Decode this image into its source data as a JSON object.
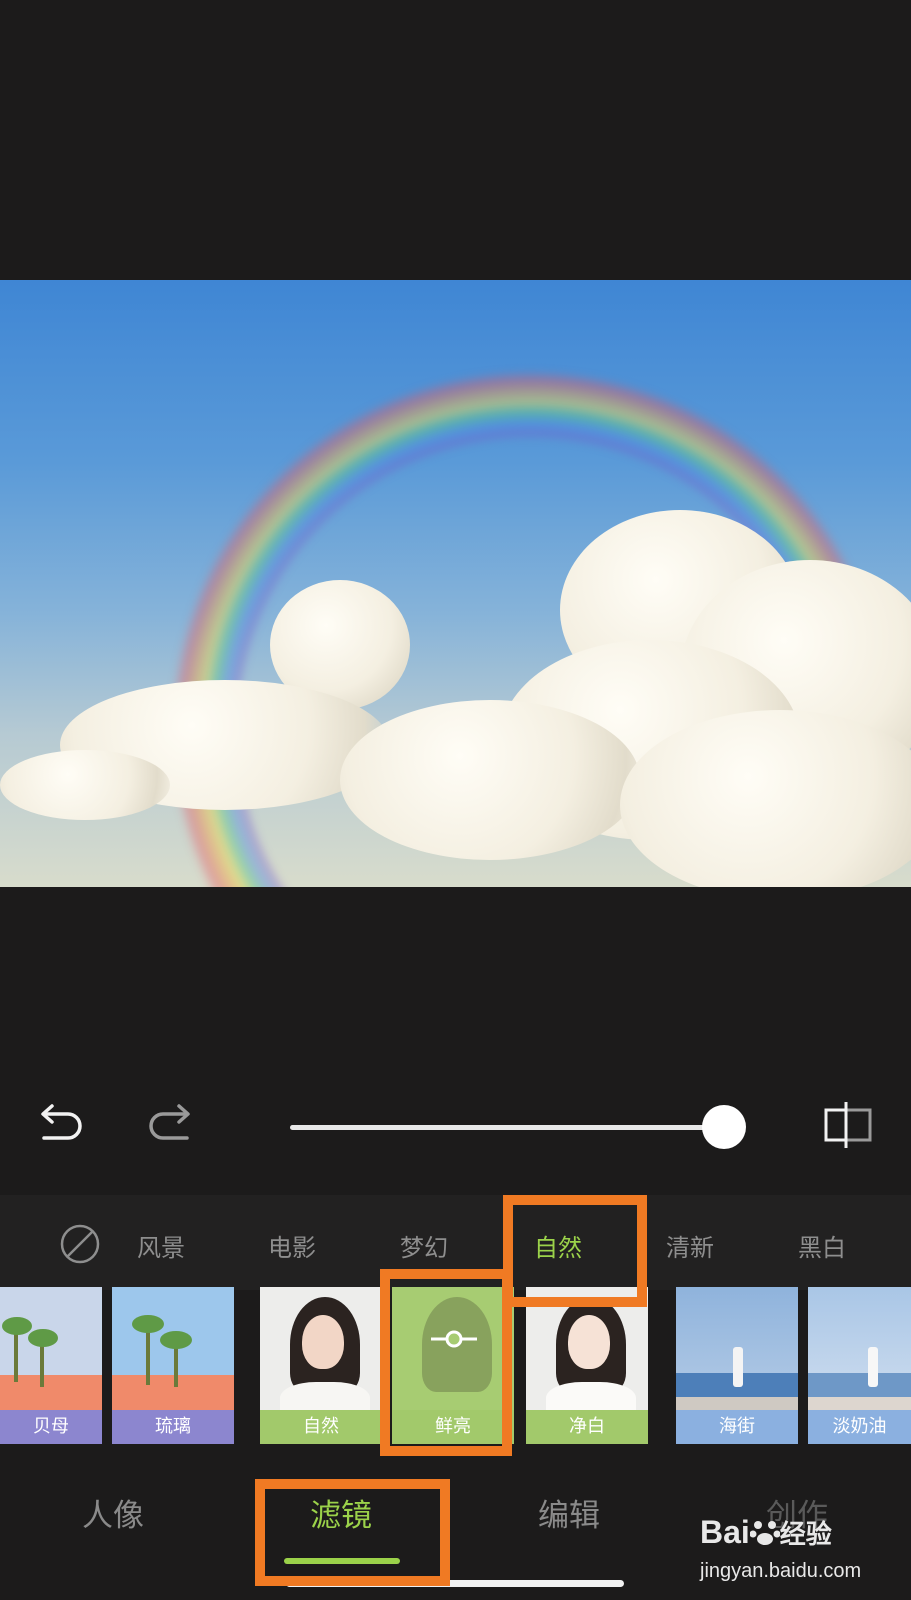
{
  "toolbar": {
    "undo_icon": "undo-icon",
    "redo_icon": "redo-icon",
    "compare_icon": "compare-icon",
    "intensity_percent": 100
  },
  "categories": {
    "none_icon": "no-filter-icon",
    "items": [
      "风景",
      "电影",
      "梦幻",
      "自然",
      "清新",
      "黑白"
    ],
    "active": "自然"
  },
  "filters": [
    {
      "label": "贝母",
      "label_color": "#8c86cf"
    },
    {
      "label": "琉璃",
      "label_color": "#8c86cf"
    },
    {
      "label": "自然",
      "label_color": "#a2c96b"
    },
    {
      "label": "鲜亮",
      "label_color": "#a2c96b",
      "selected": true,
      "adjust_icon": "slider-adjust-icon"
    },
    {
      "label": "净白",
      "label_color": "#a2c96b"
    },
    {
      "label": "海街",
      "label_color": "#8bb0e0"
    },
    {
      "label": "淡奶油",
      "label_color": "#8bb0e0"
    }
  ],
  "bottom_nav": {
    "items": [
      "人像",
      "滤镜",
      "编辑",
      "创作"
    ],
    "active": "滤镜"
  },
  "watermark": {
    "brand": "Bai",
    "brand_suffix": "经验",
    "url": "jingyan.baidu.com"
  },
  "colors": {
    "accent": "#9bd24a",
    "annotation": "#f07a23",
    "background": "#1c1b1b"
  }
}
